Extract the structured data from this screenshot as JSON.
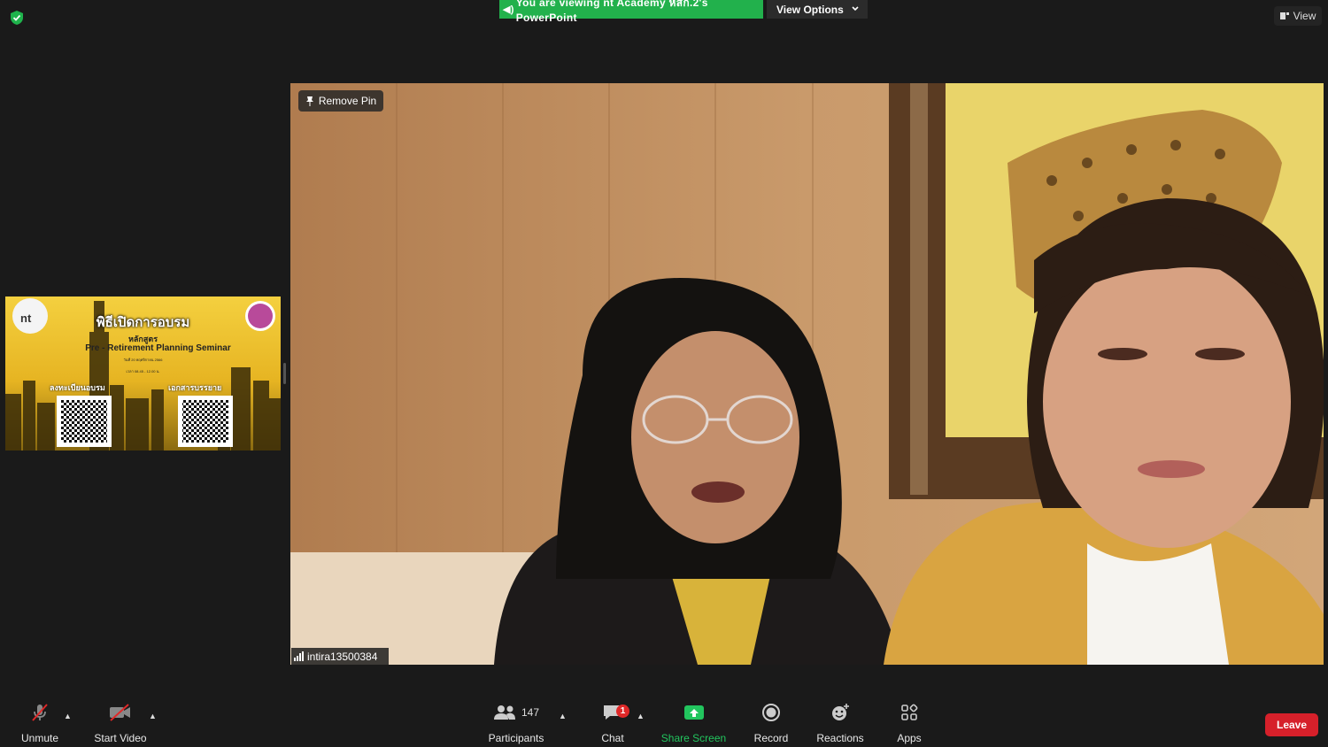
{
  "top_bar": {
    "banner_text": "You are viewing nt Academy หสก.2's PowerPoint",
    "view_options_label": "View Options",
    "view_label": "View"
  },
  "thumbnail": {
    "title": "พิธีเปิดการอบรม",
    "course_label": "หลักสูตร",
    "course_name": "Pre - Retirement Planning Seminar",
    "date_line": "วันที่ 20 พฤศจิกายน 2566",
    "time_line": "เวลา 08.45 - 12.00 น.",
    "logo_text": "nt",
    "qr_left_label": "ลงทะเบียนอบรม",
    "qr_right_label": "เอกสารบรรยาย"
  },
  "main_video": {
    "remove_pin_label": "Remove Pin",
    "participant_name": "intira13500384"
  },
  "toolbar": {
    "unmute_label": "Unmute",
    "start_video_label": "Start Video",
    "participants_label": "Participants",
    "participants_count": "147",
    "chat_label": "Chat",
    "chat_badge": "1",
    "share_screen_label": "Share Screen",
    "record_label": "Record",
    "reactions_label": "Reactions",
    "apps_label": "Apps",
    "leave_label": "Leave"
  },
  "colors": {
    "banner_green": "#22b14c",
    "share_green": "#22c55e",
    "leave_red": "#d6202a",
    "muted_red": "#e02828"
  }
}
